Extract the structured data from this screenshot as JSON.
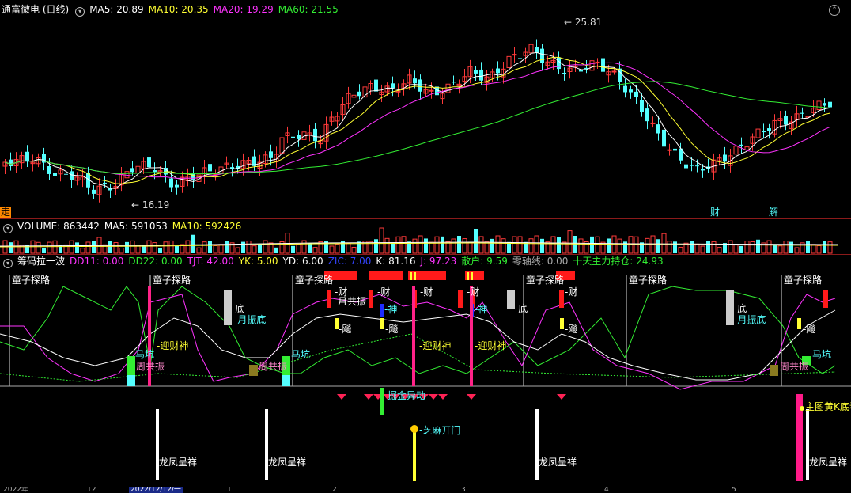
{
  "colors": {
    "up": "#ff3a3a",
    "down": "#54ffff",
    "ma5": "#ffffff",
    "ma10": "#ffff33",
    "ma20": "#ff33ff",
    "ma60": "#33ee33",
    "bg": "#000000"
  },
  "main": {
    "title": "通富微电 (日线)",
    "ma": [
      {
        "label": "MA5: 20.89",
        "color": "#ffffff"
      },
      {
        "label": "MA10: 20.35",
        "color": "#ffff33"
      },
      {
        "label": "MA20: 19.29",
        "color": "#ff33ff"
      },
      {
        "label": "MA60: 21.55",
        "color": "#33ee33"
      }
    ],
    "high_label": "25.81",
    "low_label": "16.19",
    "left_tag": "走",
    "tag_cai": "财",
    "tag_jie": "解"
  },
  "volume": {
    "labels": [
      {
        "label": "VOLUME: 863442",
        "color": "#ffffff"
      },
      {
        "label": "MA5: 591053",
        "color": "#ffffff"
      },
      {
        "label": "MA10: 592426",
        "color": "#ffff33"
      }
    ]
  },
  "indicator": {
    "labels": [
      {
        "label": "筹码拉一波",
        "color": "#ffffff"
      },
      {
        "label": "DD11: 0.00",
        "color": "#ff33ff"
      },
      {
        "label": "DD22: 0.00",
        "color": "#33ee33"
      },
      {
        "label": "TJT: 42.00",
        "color": "#ff33ff"
      },
      {
        "label": "YK: 5.00",
        "color": "#ffff33"
      },
      {
        "label": "YD: 6.00",
        "color": "#ffffff"
      },
      {
        "label": "ZIC: 7.00",
        "color": "#3344ff"
      },
      {
        "label": "K: 81.16",
        "color": "#ffffff"
      },
      {
        "label": "J: 97.23",
        "color": "#ff33ff"
      },
      {
        "label": "散户: 9.59",
        "color": "#33ee33"
      },
      {
        "label": "零轴线: 0.00",
        "color": "#aaaaaa"
      },
      {
        "label": "十天主力持仓: 24.93",
        "color": "#33ee33"
      }
    ],
    "tongzi": "童子探路",
    "signals": {
      "cai": "-财",
      "di": "-底",
      "sheng": "-神",
      "chao": "-飚",
      "yuegongzhen": "月共振",
      "yuezhendi": "-月振底",
      "mahang": "马坑",
      "zhougongzhen": "周共振",
      "yingcaishen": "-迎财神",
      "dibei": "-底",
      "jinzhou": "掘金异动"
    }
  },
  "bottom": {
    "longfeng": "龙凤呈祥",
    "zhima": "-芝麻开门",
    "zhutu": "主图黄K底看"
  },
  "dates": [
    "2022年",
    "12",
    "2022/12/12/一",
    "1",
    "2",
    "3",
    "4",
    "5"
  ]
}
